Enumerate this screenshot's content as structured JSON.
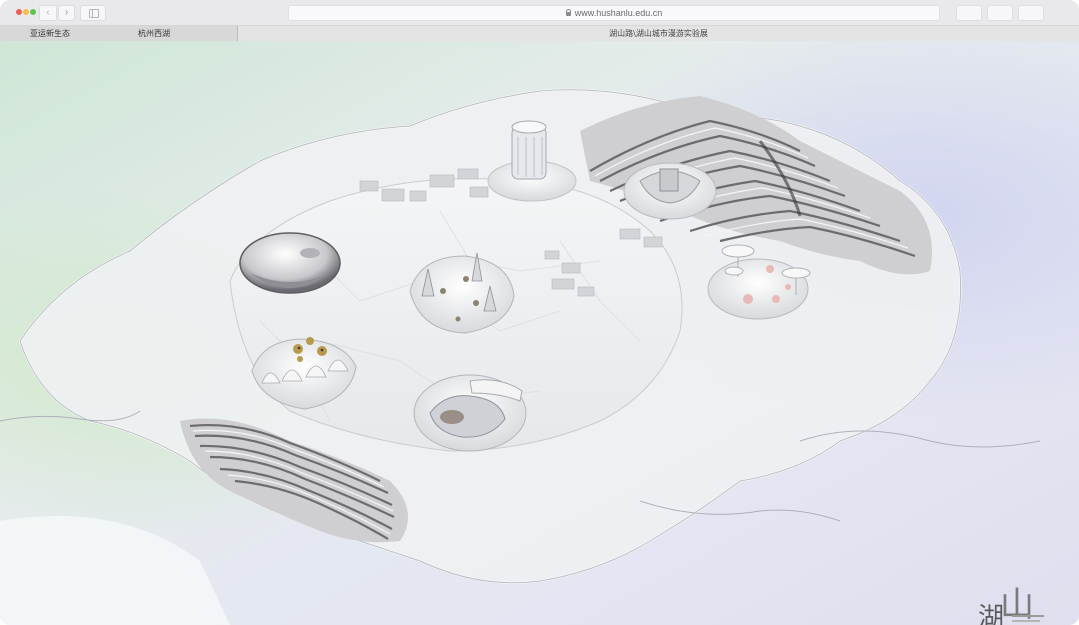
{
  "browser": {
    "url": "www.hushanlu.edu.cn",
    "back_label": "‹",
    "forward_label": "›"
  },
  "site": {
    "nav": [
      {
        "label": "亚运新生态"
      },
      {
        "label": "杭州西湖"
      }
    ],
    "page_title": "湖山路\\湖山城市漫游实验展"
  },
  "logo": {
    "char_lake": "湖",
    "char_mountain": "山"
  },
  "colors": {
    "chrome_bg": "#e9e9ec",
    "tabbar_bg": "#d8d8d8",
    "traffic_red": "#ec5f56",
    "traffic_yellow": "#f3bd4f",
    "traffic_green": "#5fc454",
    "scene_green": "#cfe8d8",
    "scene_lavender": "#d9dcf0"
  },
  "icons": [
    "lock-icon",
    "sidebar-icon",
    "back-arrow-icon",
    "forward-arrow-icon"
  ]
}
